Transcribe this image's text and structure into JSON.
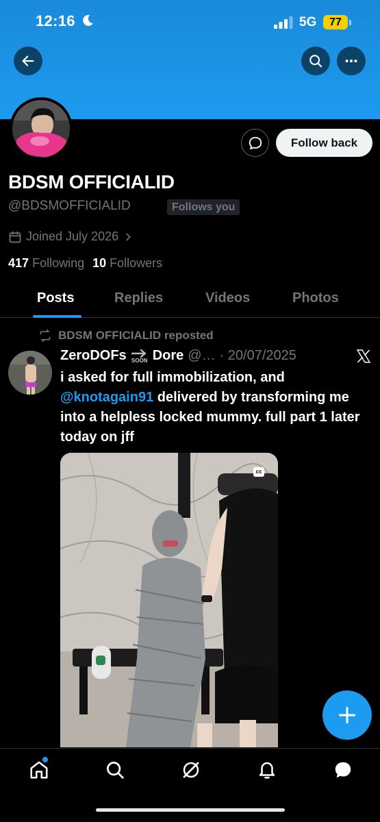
{
  "status_bar": {
    "time": "12:16",
    "network": "5G",
    "battery": "77"
  },
  "profile": {
    "display_name": "BDSM OFFICIALID",
    "handle": "@BDSMOFFICIALID",
    "follows_you": "Follows you",
    "joined": "Joined July 2026",
    "following_count": "417",
    "following_label": "Following",
    "followers_count": "10",
    "followers_label": "Followers",
    "follow_back_label": "Follow back"
  },
  "tabs": [
    "Posts",
    "Replies",
    "Videos",
    "Photos"
  ],
  "post": {
    "repost_text": "BDSM OFFICIALID reposted",
    "author_name": "ZeroDOFs",
    "soon_text": "SOON",
    "author_name_2": "Dore",
    "author_handle": "@…",
    "date": "· 20/07/2025",
    "text_1": "i asked for full immobilization, and",
    "mention": "@knotagain91",
    "text_2": " delivered by transforming me into a helpless locked mummy. full part 1 later today on jff",
    "cc_label": "cc"
  },
  "colors": {
    "accent": "#1d9bf0",
    "background": "#000000",
    "banner": "#1d9bf0"
  }
}
